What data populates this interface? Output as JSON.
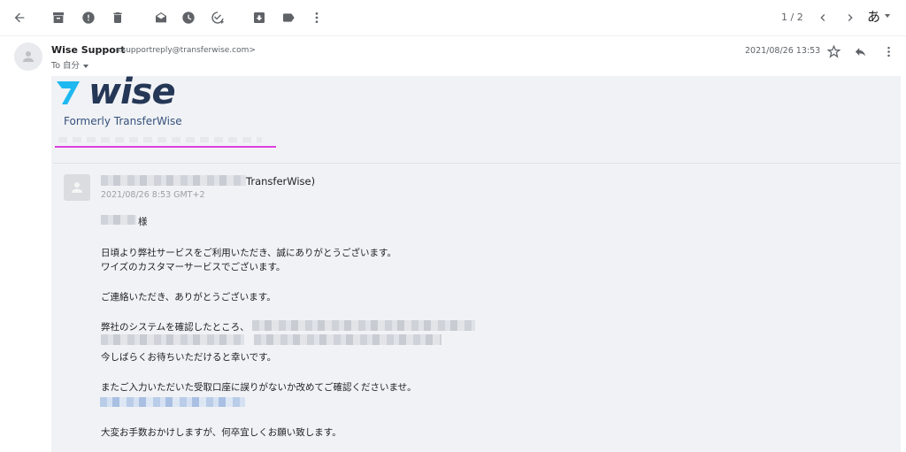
{
  "toolbar": {
    "pager": "1 / 2",
    "language": "あ"
  },
  "message": {
    "sender_name": "Wise Support",
    "sender_email": "<supportreply@transferwise.com>",
    "to_line": "To 自分",
    "date": "2021/08/26 13:53"
  },
  "content": {
    "logo_text": "wise",
    "formerly": "Formerly TransferWise",
    "inner_from": "TransferWise)",
    "inner_date": "2021/08/26 8:53 GMT+2",
    "salutation": "様",
    "p1_line1": "日頃より弊社サービスをご利用いただき、誠にありがとうございます。",
    "p1_line2": "ワイズのカスタマーサービスでございます。",
    "p2": "ご連絡いただき、ありがとうございます。",
    "p3_line1": "弊社のシステムを確認したところ、",
    "p3_line3": "今しばらくお待ちいただけると幸いです。",
    "p4": "またご入力いただいた受取口座に誤りがないか改めてご確認くださいませ。",
    "p5": "大変お手数おかけしますが、何卒宜しくお願い致します。"
  }
}
